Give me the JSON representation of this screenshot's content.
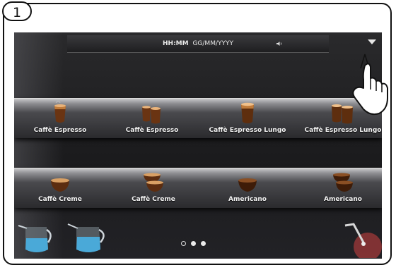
{
  "step_number": "1",
  "status_bar": {
    "time": "HH:MM",
    "date": "GG/MM/YYYY"
  },
  "drinks_row1": [
    {
      "label": "Caffè Espresso",
      "cup": "espresso-cup-icon"
    },
    {
      "label": "Caffè Espresso",
      "cup": "double-espresso-cup-icon"
    },
    {
      "label": "Caffè Espresso Lungo",
      "cup": "lungo-cup-icon"
    },
    {
      "label": "Caffè Espresso Lungo",
      "cup": "double-lungo-cup-icon"
    }
  ],
  "drinks_row2": [
    {
      "label": "Caffè Creme",
      "cup": "creme-cup-icon"
    },
    {
      "label": "Caffè Creme",
      "cup": "double-creme-cup-icon"
    },
    {
      "label": "Americano",
      "cup": "americano-cup-icon"
    },
    {
      "label": "Americano",
      "cup": "double-americano-cup-icon"
    }
  ],
  "pager": {
    "pages": 3,
    "current": 1
  },
  "colors": {
    "screen_bg": "#1b1b1d",
    "shelf_highlight": "#c9c9cb",
    "label_text": "#f3f3f3",
    "milk_blue": "#4aa9d8"
  },
  "icons": {
    "menu": "chevron-down-icon",
    "volume": "speaker-icon",
    "milk_left": "milk-jug-icon",
    "milk_right": "milk-jug-icon",
    "hot_water": "steam-wand-icon",
    "pointer": "pointing-hand-icon"
  }
}
